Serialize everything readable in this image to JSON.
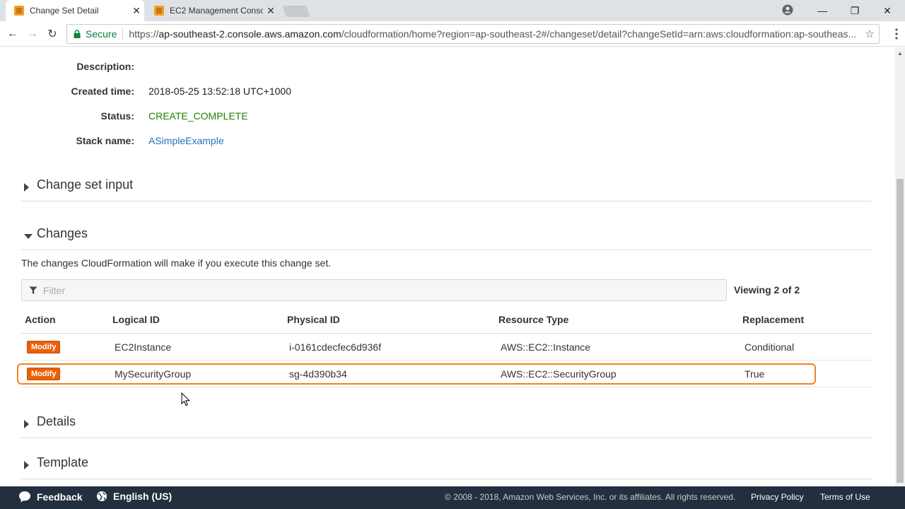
{
  "browser": {
    "tabs": [
      {
        "title": "Change Set Detail",
        "active": true
      },
      {
        "title": "EC2 Management Consol",
        "active": false
      }
    ],
    "secure_label": "Secure",
    "url_scheme": "https://",
    "url_host": "ap-southeast-2.console.aws.amazon.com",
    "url_path": "/cloudformation/home?region=ap-southeast-2#/changeset/detail?changeSetId=arn:aws:cloudformation:ap-southeas..."
  },
  "details": {
    "description_label": "Description:",
    "description_value": "",
    "created_label": "Created time:",
    "created_value": "2018-05-25 13:52:18 UTC+1000",
    "status_label": "Status:",
    "status_value": "CREATE_COMPLETE",
    "stack_label": "Stack name:",
    "stack_value": "ASimpleExample"
  },
  "sections": {
    "change_set_input": "Change set input",
    "changes": "Changes",
    "details": "Details",
    "template": "Template"
  },
  "changes": {
    "description": "The changes CloudFormation will make if you execute this change set.",
    "filter_placeholder": "Filter",
    "viewing": "Viewing 2 of 2",
    "columns": {
      "action": "Action",
      "logical_id": "Logical ID",
      "physical_id": "Physical ID",
      "resource_type": "Resource Type",
      "replacement": "Replacement"
    },
    "rows": [
      {
        "action": "Modify",
        "logical_id": "EC2Instance",
        "physical_id": "i-0161cdecfec6d936f",
        "resource_type": "AWS::EC2::Instance",
        "replacement": "Conditional"
      },
      {
        "action": "Modify",
        "logical_id": "MySecurityGroup",
        "physical_id": "sg-4d390b34",
        "resource_type": "AWS::EC2::SecurityGroup",
        "replacement": "True"
      }
    ]
  },
  "footer": {
    "feedback": "Feedback",
    "language": "English (US)",
    "copyright": "© 2008 - 2018, Amazon Web Services, Inc. or its affiliates. All rights reserved.",
    "privacy": "Privacy Policy",
    "terms": "Terms of Use"
  },
  "colors": {
    "status_green": "#1d8102",
    "link_blue": "#2672b8",
    "badge_orange": "#eb5f07",
    "highlight_orange": "#f0841b",
    "footer_bg": "#232f3e"
  }
}
